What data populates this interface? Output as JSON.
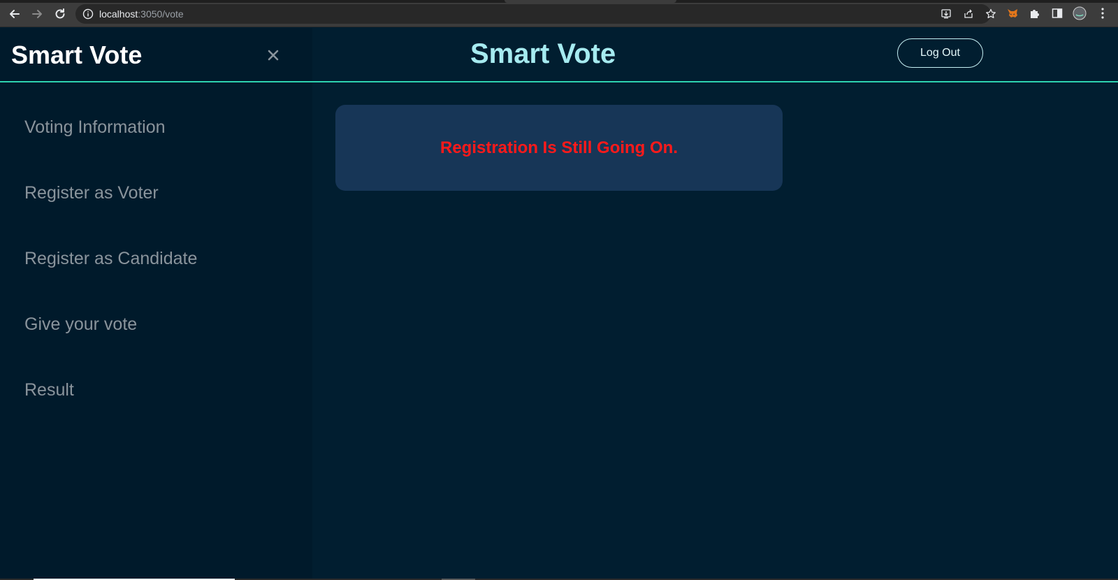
{
  "browser": {
    "url_host": "localhost",
    "url_path": ":3050/vote"
  },
  "sidebar": {
    "title": "Smart Vote",
    "items": [
      {
        "label": "Voting Information"
      },
      {
        "label": "Register as Voter"
      },
      {
        "label": "Register as Candidate"
      },
      {
        "label": "Give your vote"
      },
      {
        "label": "Result"
      }
    ]
  },
  "header": {
    "title": "Smart Vote",
    "logout_label": "Log Out"
  },
  "notice": {
    "message": "Registration Is Still Going On."
  },
  "colors": {
    "background": "#011e30",
    "sidebar": "#001a2b",
    "accent_line": "#2ed3b0",
    "title": "#a6ebf0",
    "card": "#173657",
    "alert_text": "#ff1a1a"
  }
}
